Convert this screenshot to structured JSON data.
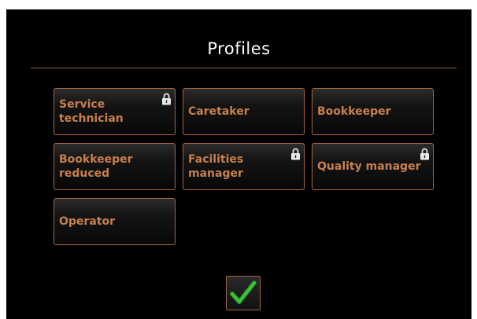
{
  "title": "Profiles",
  "profiles": [
    {
      "label": "Service technician",
      "locked": true
    },
    {
      "label": "Caretaker",
      "locked": false
    },
    {
      "label": "Bookkeeper",
      "locked": false
    },
    {
      "label": "Bookkeeper\nreduced",
      "locked": false
    },
    {
      "label": "Facilities manager",
      "locked": true
    },
    {
      "label": "Quality manager",
      "locked": true
    },
    {
      "label": "Operator",
      "locked": false
    }
  ],
  "confirm_icon": "checkmark-icon",
  "lock_icon": "padlock-icon",
  "colors": {
    "background": "#000000",
    "accent": "#c87f4d",
    "border": "#a8673c",
    "title": "#ffffff",
    "check": "#3cc43c"
  }
}
